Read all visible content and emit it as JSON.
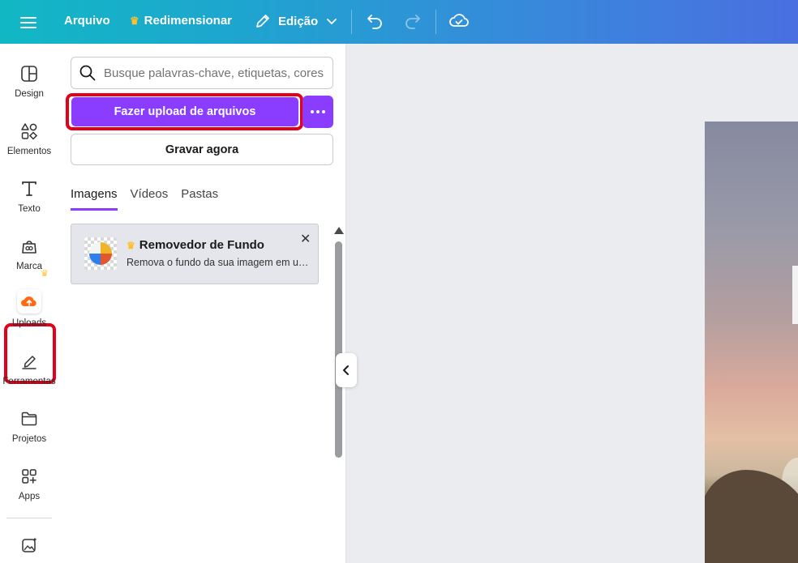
{
  "topbar": {
    "arquivo": "Arquivo",
    "redimensionar": "Redimensionar",
    "edicao": "Edição"
  },
  "rail": {
    "items": [
      {
        "label": "Design"
      },
      {
        "label": "Elementos"
      },
      {
        "label": "Texto"
      },
      {
        "label": "Marca"
      },
      {
        "label": "Uploads"
      },
      {
        "label": "Ferramentas"
      },
      {
        "label": "Projetos"
      },
      {
        "label": "Apps"
      }
    ]
  },
  "panel": {
    "search_placeholder": "Busque palavras-chave, etiquetas, cores",
    "upload_button": "Fazer upload de arquivos",
    "record_button": "Gravar agora",
    "tabs": [
      {
        "label": "Imagens",
        "active": true
      },
      {
        "label": "Vídeos",
        "active": false
      },
      {
        "label": "Pastas",
        "active": false
      }
    ],
    "promo_card": {
      "title": "Removedor de Fundo",
      "description": "Remova o fundo da sua imagem em um clique"
    }
  },
  "colors": {
    "accent": "#8b3dff",
    "highlight": "#e3001b",
    "premium": "#ffbf2e"
  },
  "icons": [
    "menu-icon",
    "crown-icon",
    "pen-icon",
    "chevron-down-icon",
    "undo-icon",
    "redo-icon",
    "cloud-check-icon",
    "search-icon",
    "more-icon",
    "close-icon",
    "chevron-left-icon"
  ]
}
